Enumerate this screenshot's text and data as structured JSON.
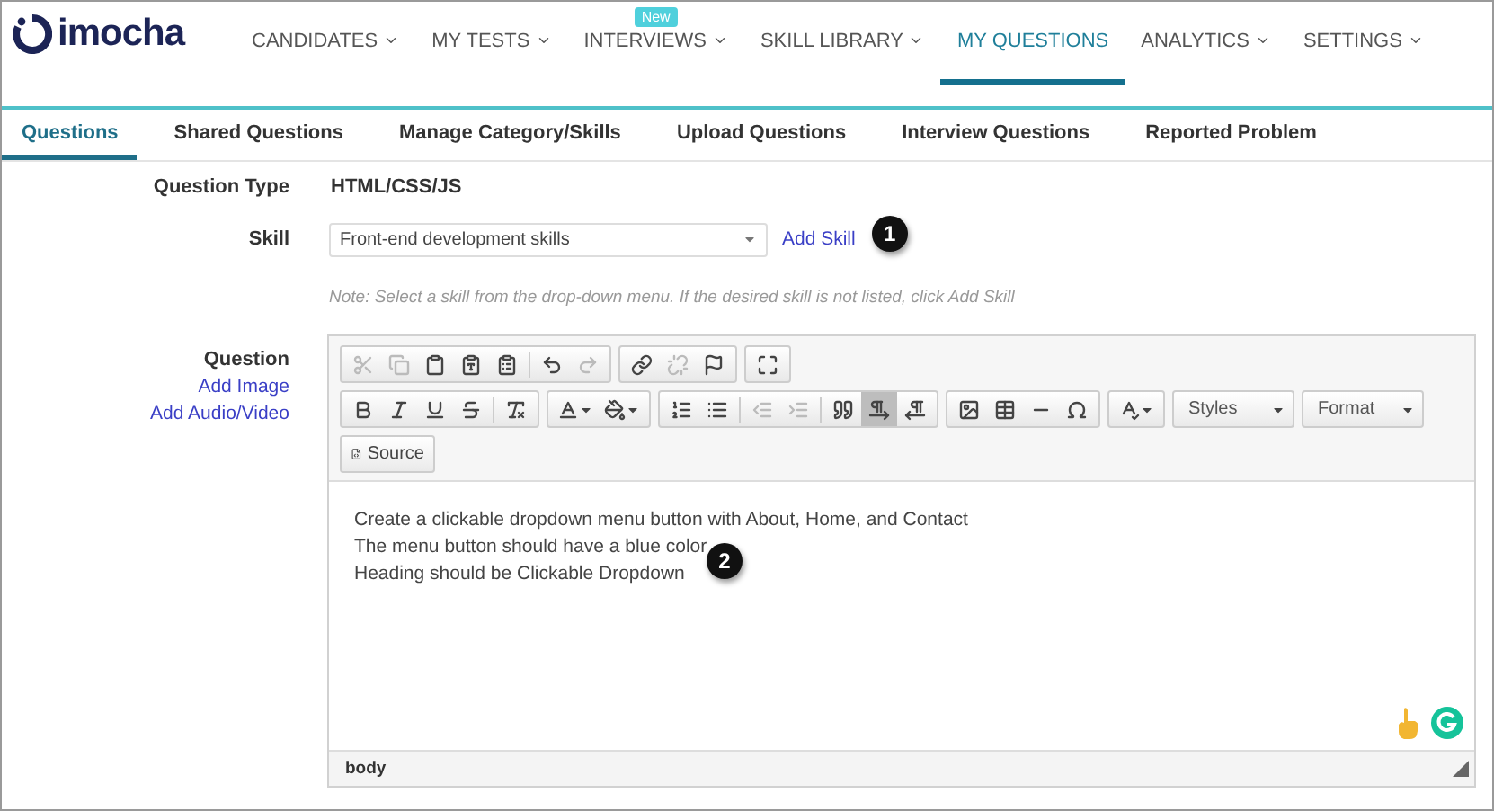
{
  "logo": {
    "text": "imocha"
  },
  "nav": [
    {
      "label": "CANDIDATES",
      "selected": false
    },
    {
      "label": "MY TESTS",
      "selected": false
    },
    {
      "label": "INTERVIEWS",
      "selected": false,
      "badge": "New"
    },
    {
      "label": "SKILL LIBRARY",
      "selected": false
    },
    {
      "label": "MY QUESTIONS",
      "selected": true,
      "chevron": false
    },
    {
      "label": "ANALYTICS",
      "selected": false
    },
    {
      "label": "SETTINGS",
      "selected": false
    }
  ],
  "tabs": [
    {
      "label": "Questions",
      "selected": true
    },
    {
      "label": "Shared Questions",
      "selected": false
    },
    {
      "label": "Manage Category/Skills",
      "selected": false
    },
    {
      "label": "Upload Questions",
      "selected": false
    },
    {
      "label": "Interview Questions",
      "selected": false
    },
    {
      "label": "Reported Problem",
      "selected": false
    }
  ],
  "question_type": {
    "label": "Question Type",
    "value": "HTML/CSS/JS"
  },
  "skill": {
    "label": "Skill",
    "value": "Front-end development skills",
    "link": "Add Skill",
    "marker": "1",
    "note": "Note: Select a skill from the drop-down menu. If the desired skill is not listed, click Add Skill"
  },
  "question": {
    "label": "Question",
    "links": [
      "Add Image",
      "Add Audio/Video"
    ]
  },
  "toolbar": {
    "row_1": [
      [
        {
          "disabled": true
        },
        {
          "disabled": true
        },
        {
          "disabled": false
        },
        {
          "disabled": false
        },
        {
          "disabled": false
        },
        {
          "disabled": false
        },
        {
          "disabled": true
        }
      ],
      [
        {
          "disabled": false
        },
        {
          "disabled": true
        },
        {
          "disabled": false
        }
      ],
      [
        {
          "disabled": false
        }
      ]
    ],
    "row_2": [
      [
        {
          "disabled": false
        },
        {
          "disabled": false
        },
        {
          "disabled": false
        },
        {
          "disabled": false
        },
        {
          "disabled": false
        }
      ],
      [
        {
          "disabled": false
        },
        {
          "disabled": false
        }
      ],
      [
        {
          "disabled": false,
          "selected": false
        },
        {
          "disabled": false,
          "selected": false
        },
        {
          "disabled": true,
          "selected": false
        },
        {
          "disabled": true,
          "selected": false
        },
        {
          "disabled": false,
          "selected": false
        },
        {
          "disabled": false,
          "selected": true
        },
        {
          "disabled": false,
          "selected": false
        }
      ],
      [
        {
          "disabled": false
        },
        {
          "disabled": false
        },
        {
          "disabled": false
        },
        {
          "disabled": false
        }
      ],
      [
        {
          "disabled": false
        }
      ]
    ],
    "combos": [
      "Styles",
      "Format"
    ],
    "source": "Source"
  },
  "content": [
    "Create a clickable dropdown menu button with About, Home, and Contact",
    "The menu button should have a blue color",
    "Heading should be Clickable Dropdown"
  ],
  "content_marker": "2",
  "status_path": "body"
}
